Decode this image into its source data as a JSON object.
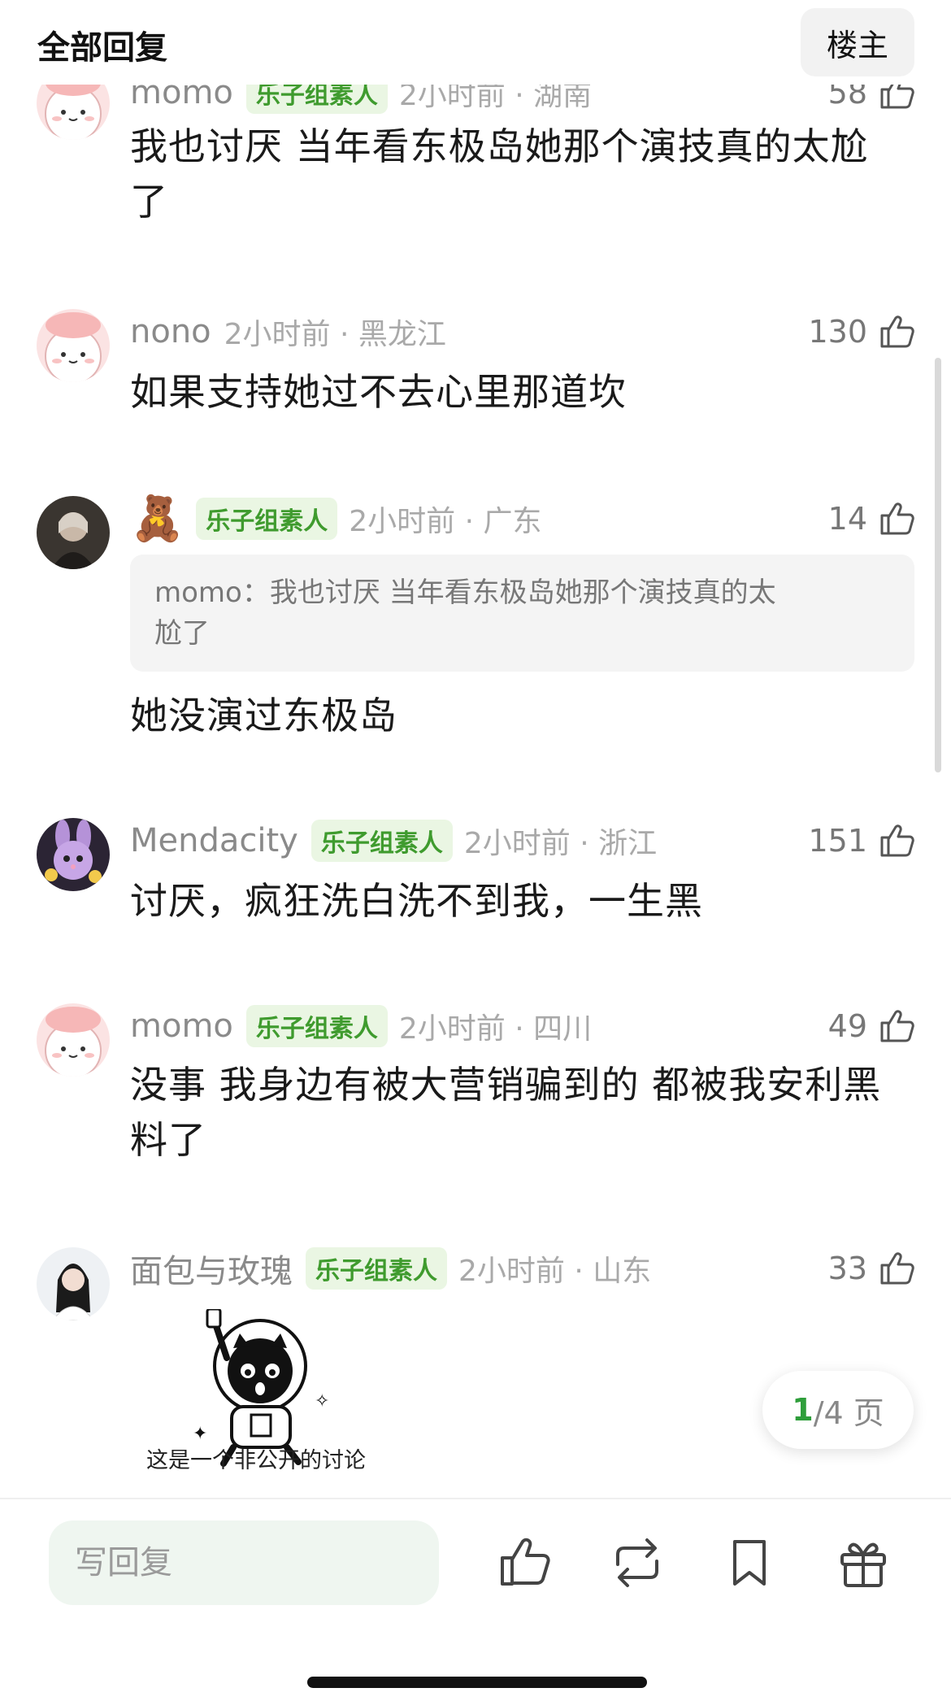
{
  "header": {
    "title": "全部回复",
    "owner_button": "楼主"
  },
  "comments": [
    {
      "username": "momo",
      "badge": "乐子组素人",
      "time_loc": "2小时前 · 湖南",
      "likes": "58",
      "text_line1": "我也讨厌 当年看东极岛她那个演技真的太尬",
      "text_line2": "了"
    },
    {
      "username": "nono",
      "badge": "",
      "time_loc": "2小时前 · 黑龙江",
      "likes": "130",
      "text_line1": "如果支持她过不去心里那道坎"
    },
    {
      "username": "🧸",
      "badge": "乐子组素人",
      "time_loc": "2小时前 · 广东",
      "likes": "14",
      "quote_line1": "momo：我也讨厌 当年看东极岛她那个演技真的太",
      "quote_line2": "尬了",
      "text_line1": "她没演过东极岛"
    },
    {
      "username": "Mendacity",
      "badge": "乐子组素人",
      "time_loc": "2小时前 · 浙江",
      "likes": "151",
      "text_line1": "讨厌，疯狂洗白洗不到我，一生黑"
    },
    {
      "username": "momo",
      "badge": "乐子组素人",
      "time_loc": "2小时前 · 四川",
      "likes": "49",
      "text_line1": "没事 我身边有被大营销骗到的 都被我安利黑",
      "text_line2": "料了"
    },
    {
      "username": "面包与玫瑰",
      "badge": "乐子组素人",
      "time_loc": "2小时前 · 山东",
      "likes": "33",
      "sticker_caption": "这是一个非公开的讨论"
    }
  ],
  "pagination": {
    "current": "1",
    "total_text": "/4 页"
  },
  "bottom_bar": {
    "reply_placeholder": "写回复",
    "icons": [
      "thumb-up-icon",
      "repost-icon",
      "bookmark-icon",
      "gift-icon"
    ]
  },
  "colors": {
    "accent_green": "#3f9b2e",
    "badge_bg": "#eaf6e3",
    "muted_text": "#8a8a8a"
  }
}
